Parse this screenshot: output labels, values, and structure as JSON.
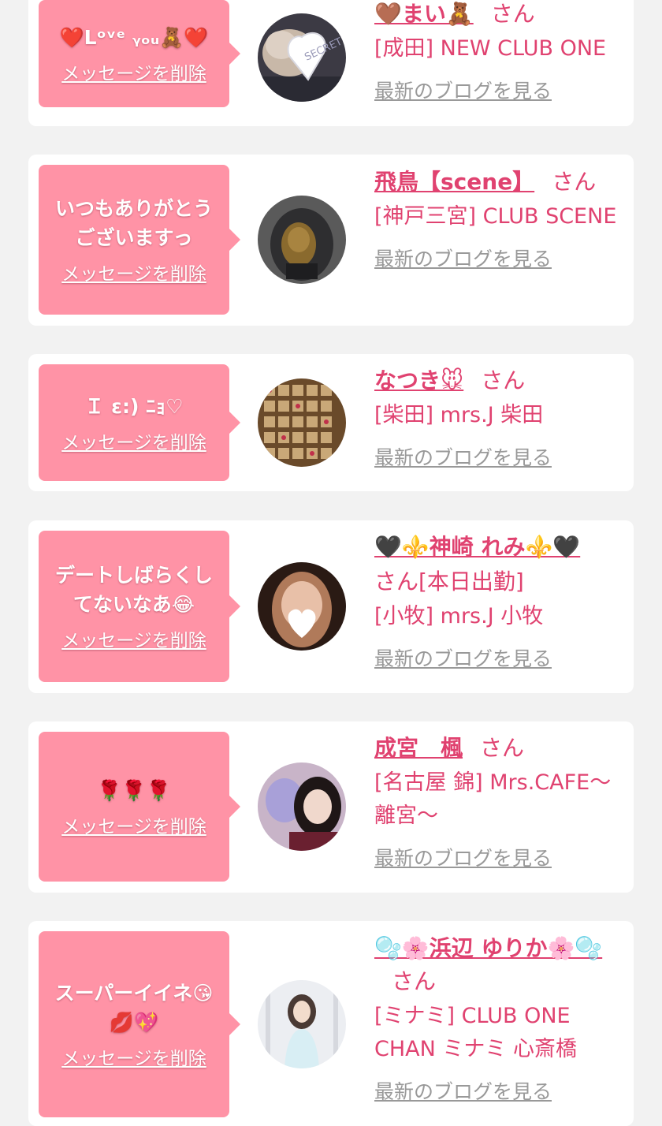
{
  "messages": [
    {
      "bubble_text": "❤️Lᵒᵛᵉ ᵧₒᵤ🧸❤️",
      "delete_label": "メッセージを削除",
      "cast_name": "🤎まい🧸",
      "san_label": "さん",
      "shop": "[成田] NEW CLUB ONE",
      "blog_label": "最新のブログを見る"
    },
    {
      "bubble_text": "いつもありがとう\nございますっ",
      "delete_label": "メッセージを削除",
      "cast_name": "飛鳥【scene】",
      "san_label": "さん",
      "shop": "[神戸三宮] CLUB SCENE",
      "blog_label": "最新のブログを見る"
    },
    {
      "bubble_text": "Ｉ ε:) ﾆｮ♡",
      "delete_label": "メッセージを削除",
      "cast_name": "なつき🐭",
      "san_label": "さん",
      "shop": "[柴田] mrs.J 柴田",
      "blog_label": "最新のブログを見る"
    },
    {
      "bubble_text": "デートしばらくし\nてないなあ😂",
      "delete_label": "メッセージを削除",
      "cast_name": "🖤⚜️神崎 れみ⚜️🖤",
      "san_label": "さん[本日出勤]",
      "shop": "[小牧] mrs.J 小牧",
      "blog_label": "最新のブログを見る"
    },
    {
      "bubble_text": "🌹🌹🌹",
      "delete_label": "メッセージを削除",
      "cast_name": "成宮　楓",
      "san_label": "さん",
      "shop": "[名古屋 錦] Mrs.CAFE〜離宮〜",
      "blog_label": "最新のブログを見る"
    },
    {
      "bubble_text": "スーパーイイネ😘\n💋💖",
      "delete_label": "メッセージを削除",
      "cast_name": "🫧🌸浜辺 ゆりか🌸🫧",
      "san_label": "さん",
      "shop": "[ミナミ] CLUB ONE CHAN ミナミ 心斎橋",
      "blog_label": "最新のブログを見る"
    }
  ]
}
